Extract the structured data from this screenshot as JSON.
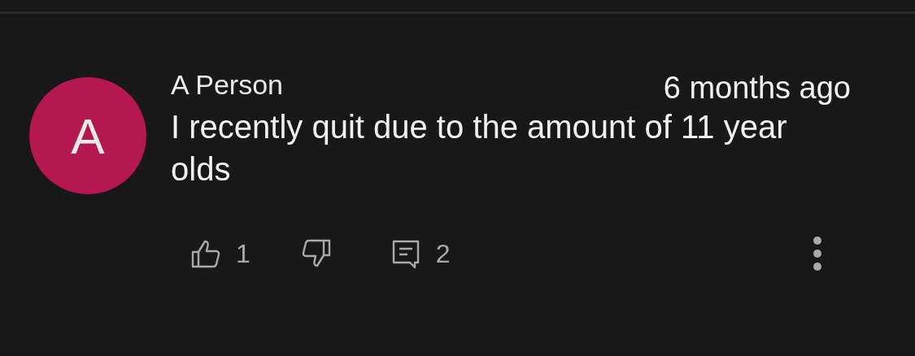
{
  "comment": {
    "avatar": {
      "letter": "A",
      "color": "#b5174f"
    },
    "author": "A Person",
    "time": "6 months ago",
    "text": "I recently quit due to the amount of 11 year olds",
    "likes": "1",
    "replies": "2"
  }
}
